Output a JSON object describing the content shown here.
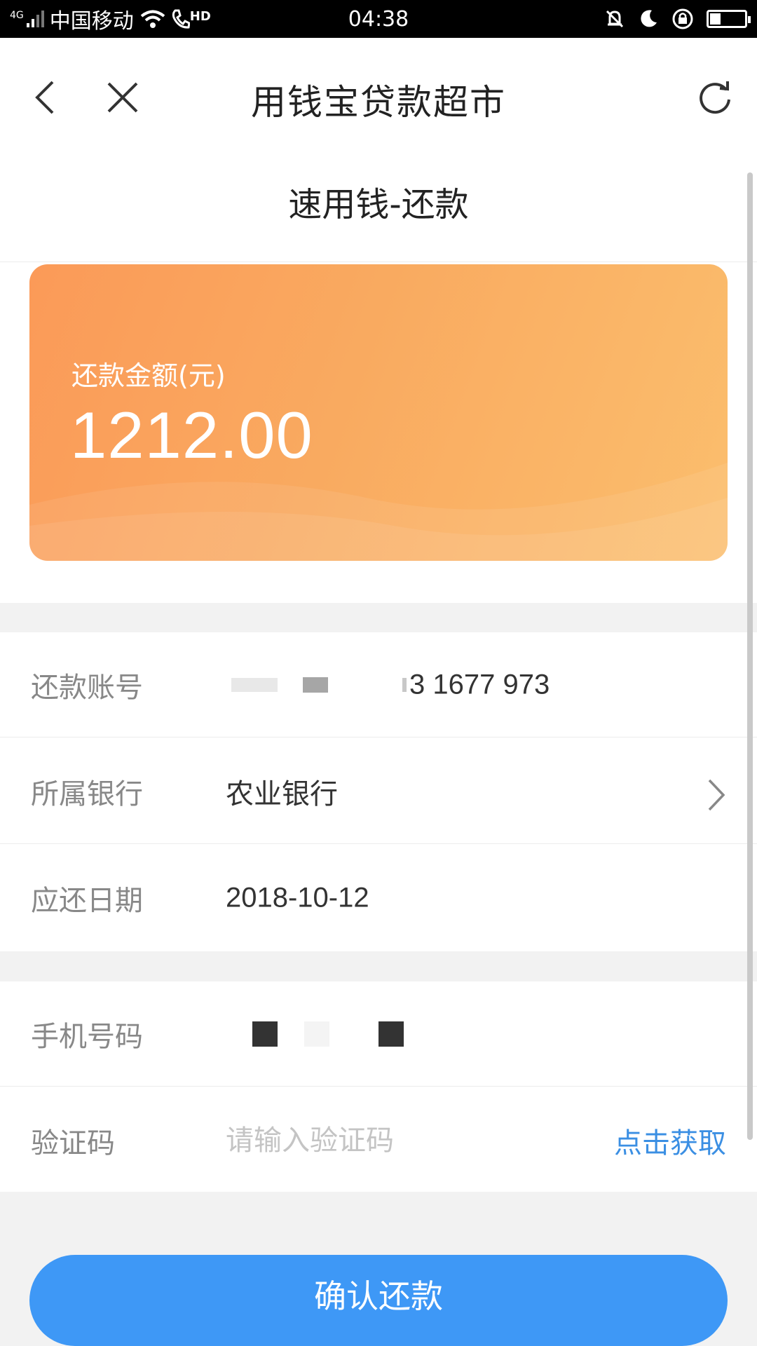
{
  "status_bar": {
    "network_tag": "4G",
    "carrier": "中国移动",
    "hd_tag": "HD",
    "time": "04:38",
    "battery_level": 0.32
  },
  "nav": {
    "title": "用钱宝贷款超市",
    "back_icon": "chevron-left-icon",
    "close_icon": "close-icon",
    "refresh_icon": "refresh-icon"
  },
  "subtitle": "速用钱-还款",
  "card": {
    "label": "还款金额(元)",
    "amount": "1212.00",
    "gradient": [
      "#fb9a58",
      "#fbbe6d"
    ]
  },
  "repayment_info": {
    "account": {
      "label": "还款账号",
      "value_visible": "3 1677 973"
    },
    "bank": {
      "label": "所属银行",
      "value": "农业银行"
    },
    "due_date": {
      "label": "应还日期",
      "value": "2018-10-12"
    }
  },
  "verification": {
    "phone": {
      "label": "手机号码"
    },
    "code": {
      "label": "验证码",
      "placeholder": "请输入验证码",
      "action": "点击获取"
    }
  },
  "confirm_button": {
    "label": "确认还款",
    "color": "#3e98f6"
  },
  "link_color": "#3b8fe3"
}
